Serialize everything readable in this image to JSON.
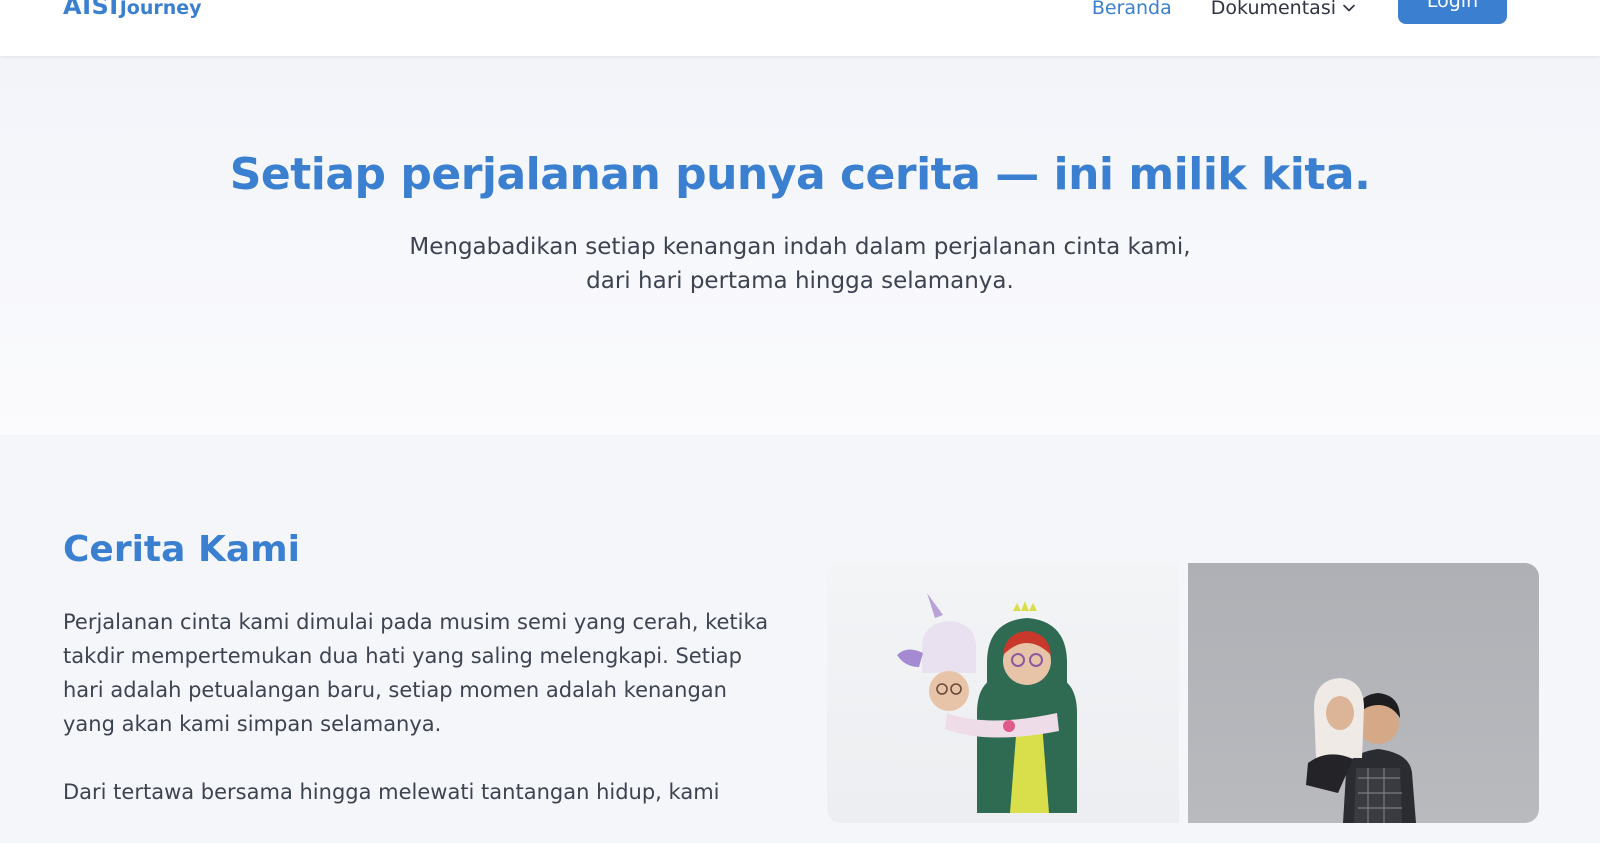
{
  "brand": {
    "main": "AISI",
    "sub": "Journey"
  },
  "nav": {
    "home": "Beranda",
    "docs": "Dokumentasi",
    "login": "Login"
  },
  "hero": {
    "title": "Setiap perjalanan punya cerita — ini milik kita.",
    "subtitle": "Mengabadikan setiap kenangan indah dalam perjalanan cinta kami, dari hari pertama hingga selamanya."
  },
  "story": {
    "title": "Cerita Kami",
    "paragraph1": "Perjalanan cinta kami dimulai pada musim semi yang cerah, ketika takdir mempertemukan dua hati yang saling melengkapi. Setiap hari adalah petualangan baru, setiap momen adalah kenangan yang akan kami simpan selamanya.",
    "paragraph2": "Dari tertawa bersama hingga melewati tantangan hidup, kami"
  },
  "colors": {
    "accent": "#3a7fd0",
    "text": "#3d4350",
    "background": "#f5f6fa"
  }
}
